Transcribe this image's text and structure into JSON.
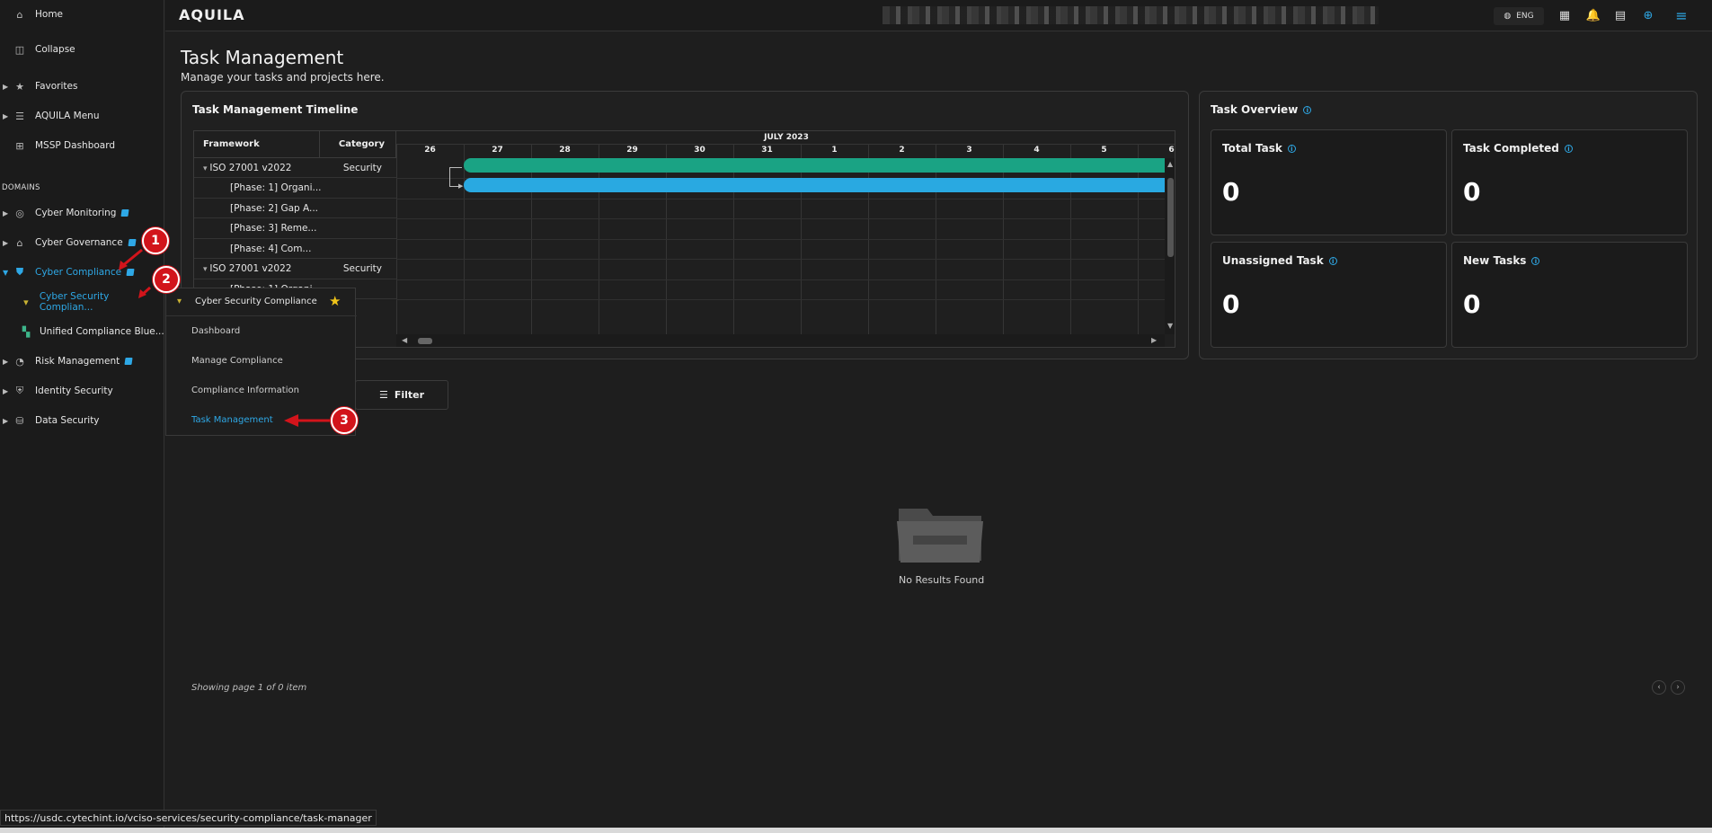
{
  "sidebar": {
    "home": "Home",
    "collapse": "Collapse",
    "favorites": "Favorites",
    "aquila_menu": "AQUILA Menu",
    "mssp_dashboard": "MSSP Dashboard",
    "domains_label": "DOMAINS",
    "cyber_monitoring": "Cyber Monitoring",
    "cyber_governance": "Cyber Governance",
    "cyber_compliance": "Cyber Compliance",
    "cyber_security_compliance": "Cyber Security Complian...",
    "unified_compliance": "Unified Compliance Blue...",
    "risk_management": "Risk Management",
    "identity_security": "Identity Security",
    "data_security": "Data Security"
  },
  "topbar": {
    "logo": "AQUILA",
    "language": "ENG"
  },
  "page": {
    "title": "Task Management",
    "subtitle": "Manage your tasks and projects here."
  },
  "timeline": {
    "title": "Task Management Timeline",
    "col_framework": "Framework",
    "col_category": "Category",
    "month": "JULY 2023",
    "days": [
      "26",
      "27",
      "28",
      "29",
      "30",
      "31",
      "1",
      "2",
      "3",
      "4",
      "5",
      "6"
    ],
    "rows": [
      {
        "name": "ISO 27001 v2022",
        "category": "Security"
      },
      {
        "name": "[Phase: 1] Organi...",
        "category": ""
      },
      {
        "name": "[Phase: 2] Gap A...",
        "category": ""
      },
      {
        "name": "[Phase: 3] Reme...",
        "category": ""
      },
      {
        "name": "[Phase: 4] Com...",
        "category": ""
      },
      {
        "name": "ISO 27001 v2022",
        "category": "Security"
      },
      {
        "name": "[Phase: 1] Organi...",
        "category": ""
      }
    ],
    "bar_colors": [
      "#1aa384",
      "#29a9e1"
    ]
  },
  "overview": {
    "title": "Task Overview",
    "cards": [
      {
        "label": "Total Task",
        "value": "0"
      },
      {
        "label": "Task Completed",
        "value": "0"
      },
      {
        "label": "Unassigned Task",
        "value": "0"
      },
      {
        "label": "New Tasks",
        "value": "0"
      }
    ]
  },
  "flyout": {
    "header": "Cyber Security Compliance",
    "items": [
      "Dashboard",
      "Manage Compliance",
      "Compliance Information",
      "Task Management"
    ]
  },
  "filter_label": "Filter",
  "empty_state": "No Results Found",
  "paging_text": "Showing page 1 of 0 item",
  "status_url": "https://usdc.cytechint.io/vciso-services/security-compliance/task-manager",
  "callouts": [
    "1",
    "2",
    "3"
  ]
}
